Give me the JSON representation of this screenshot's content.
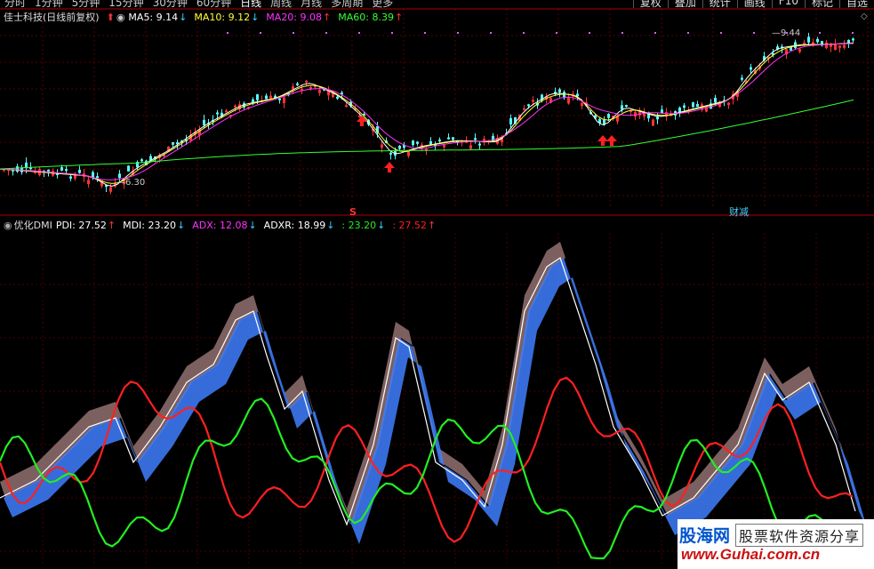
{
  "topbar": {
    "period_tabs": [
      "分时",
      "1分钟",
      "5分钟",
      "15分钟",
      "30分钟",
      "60分钟",
      "日线",
      "周线",
      "月线",
      "多周期",
      "更多"
    ],
    "right_tabs": [
      "复权",
      "叠加",
      "统计",
      "画线",
      "F10",
      "标记",
      "自选"
    ]
  },
  "main_chart": {
    "stock_title": "佳士科技(日线前复权)",
    "ma5": "MA5: 9.14",
    "ma10": "MA10: 9.12",
    "ma20": "MA20: 9.08",
    "ma60": "MA60: 8.39",
    "high_label": "9.44",
    "low_label": "6.30",
    "marker_s": "S",
    "marker_finance": "财减",
    "colors": {
      "ma5": "#ffffff",
      "ma10": "#ffff33",
      "ma20": "#ff33ff",
      "ma60": "#33ff33",
      "up": "#ff3333",
      "down": "#55ffff"
    }
  },
  "indicator": {
    "name": "优化DMI",
    "pdi": "PDI: 27.52",
    "mdi": "MDI: 23.20",
    "adx": "ADX: 12.08",
    "adxr": "ADXR: 18.99",
    "v1": ": 23.20",
    "v2": ": 27.52",
    "colors": {
      "pdi": "#ff2020",
      "mdi": "#22ee22",
      "adx": "#ffffff",
      "fill_up": "#8a6a6a",
      "fill_down": "#3f7fff"
    }
  },
  "watermark": {
    "logo": "股海网",
    "slogan": "股票软件资源分享",
    "url": "www.Guhai.com.cn"
  }
}
